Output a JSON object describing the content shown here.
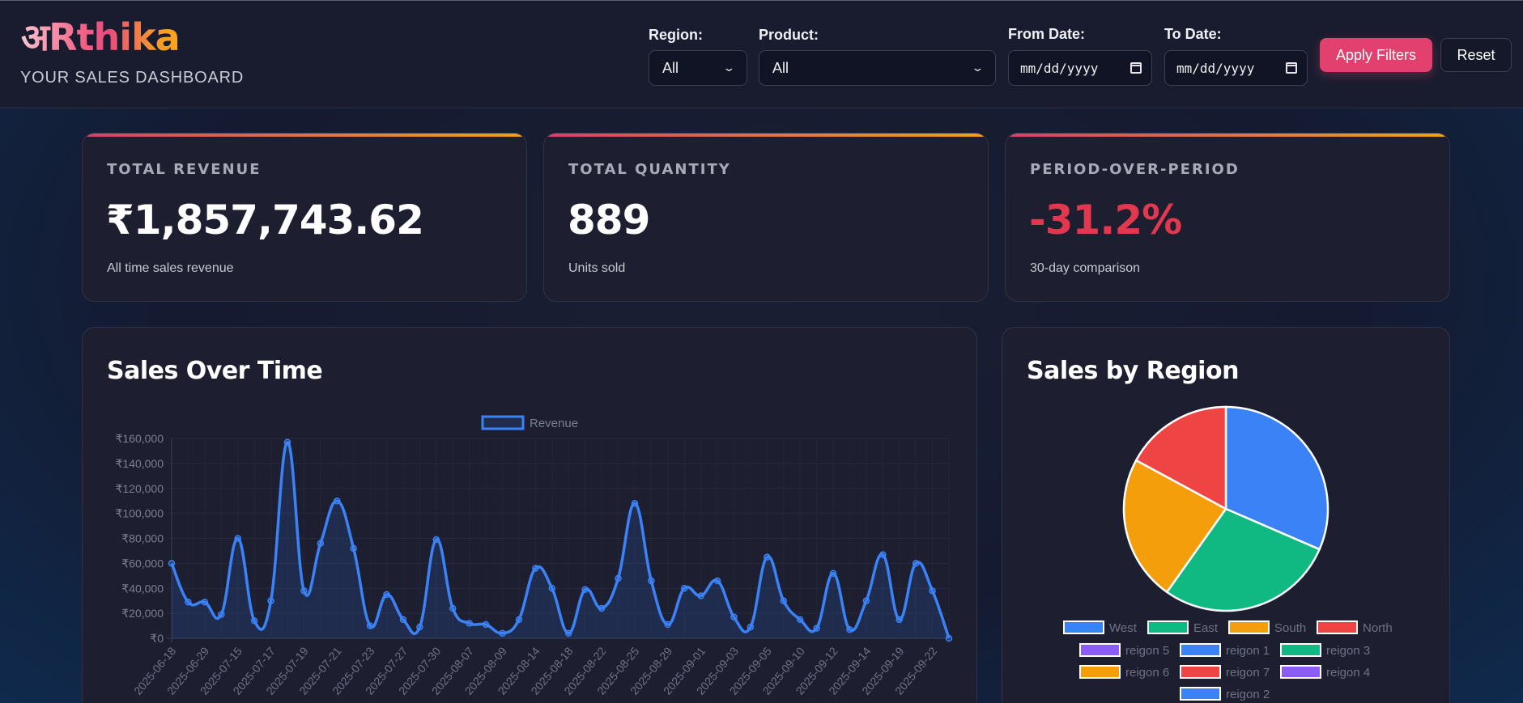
{
  "header": {
    "logo": "अRthika",
    "tagline": "YOUR SALES DASHBOARD",
    "filters": {
      "region_label": "Region:",
      "region_value": "All",
      "product_label": "Product:",
      "product_value": "All",
      "from_label": "From Date:",
      "from_placeholder": "mm/dd/yyyy",
      "to_label": "To Date:",
      "to_placeholder": "mm/dd/yyyy"
    },
    "apply_label": "Apply Filters",
    "reset_label": "Reset"
  },
  "kpis": [
    {
      "title": "TOTAL REVENUE",
      "value": "₹1,857,743.62",
      "sub": "All time sales revenue"
    },
    {
      "title": "TOTAL QUANTITY",
      "value": "889",
      "sub": "Units sold"
    },
    {
      "title": "PERIOD-OVER-PERIOD",
      "value": "-31.2%",
      "sub": "30-day comparison"
    }
  ],
  "colors": {
    "accent": "#e2406f",
    "line": "#3b82f6",
    "negative": "#e2384f"
  },
  "charts": {
    "sales_title": "Sales Over Time",
    "region_title": "Sales by Region"
  },
  "chart_data": [
    {
      "type": "line",
      "title": "Sales Over Time",
      "legend": [
        "Revenue"
      ],
      "legend_position": "top",
      "ylim": [
        0,
        160000
      ],
      "y_ticks": [
        "₹0",
        "₹20,000",
        "₹40,000",
        "₹60,000",
        "₹80,000",
        "₹100,000",
        "₹120,000",
        "₹140,000",
        "₹160,000"
      ],
      "x_tick_labels": [
        "2025-06-18",
        "2025-06-29",
        "2025-07-15",
        "2025-07-17",
        "2025-07-19",
        "2025-07-21",
        "2025-07-23",
        "2025-07-27",
        "2025-07-30",
        "2025-08-07",
        "2025-08-09",
        "2025-08-14",
        "2025-08-18",
        "2025-08-22",
        "2025-08-25",
        "2025-08-29",
        "2025-09-01",
        "2025-09-03",
        "2025-09-05",
        "2025-09-10",
        "2025-09-12",
        "2025-09-14",
        "2025-09-19",
        "2025-09-22"
      ],
      "grid": true,
      "series": [
        {
          "name": "Revenue",
          "values": [
            60000,
            29000,
            29000,
            19000,
            80000,
            14000,
            30000,
            157000,
            38000,
            76000,
            110000,
            72000,
            10000,
            35000,
            15000,
            9000,
            79000,
            24000,
            12000,
            11000,
            4000,
            15000,
            56000,
            40000,
            4000,
            39000,
            24000,
            48000,
            108000,
            46000,
            11000,
            40000,
            34000,
            46000,
            17000,
            9000,
            65000,
            30000,
            15000,
            8000,
            52000,
            7000,
            30000,
            67000,
            15000,
            60000,
            38000,
            0
          ]
        }
      ]
    },
    {
      "type": "pie",
      "title": "Sales by Region",
      "legend_position": "bottom",
      "legend": [
        "West",
        "East",
        "South",
        "North",
        "reigon 5",
        "reigon 1",
        "reigon 3",
        "reigon 6",
        "reigon 7",
        "reigon 4",
        "reigon 2"
      ],
      "legend_colors": [
        "#3b82f6",
        "#10b981",
        "#f59e0b",
        "#ef4444",
        "#8b5cf6",
        "#3b82f6",
        "#10b981",
        "#f59e0b",
        "#ef4444",
        "#8b5cf6",
        "#3b82f6"
      ],
      "slices": [
        {
          "name": "West",
          "value": 31.5,
          "color": "#3b82f6"
        },
        {
          "name": "East",
          "value": 28.3,
          "color": "#10b981"
        },
        {
          "name": "South",
          "value": 23.1,
          "color": "#f59e0b"
        },
        {
          "name": "North",
          "value": 17.1,
          "color": "#ef4444"
        }
      ]
    }
  ]
}
